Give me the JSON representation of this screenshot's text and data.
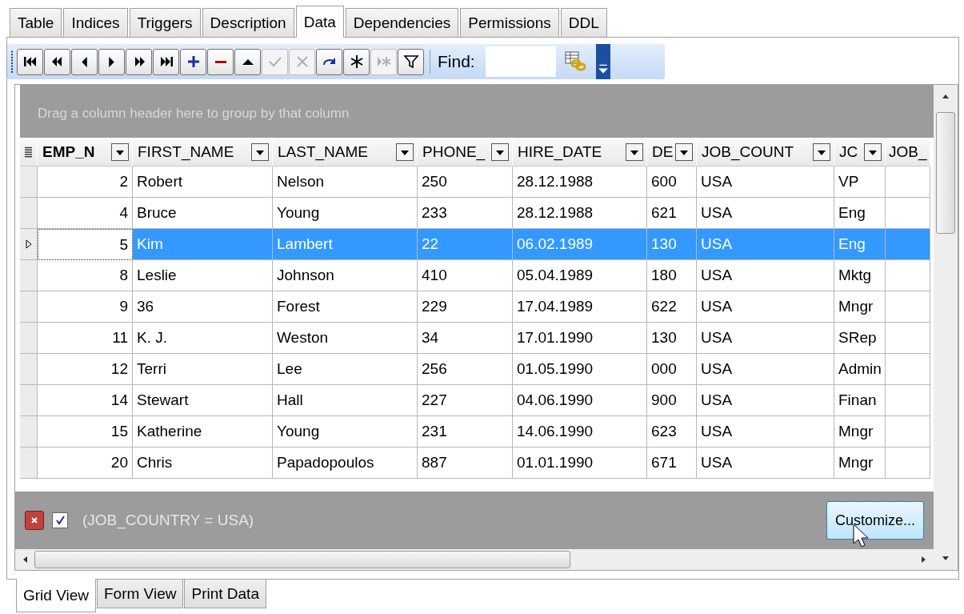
{
  "tabs": [
    {
      "label": "Table",
      "selected": false
    },
    {
      "label": "Indices",
      "selected": false
    },
    {
      "label": "Triggers",
      "selected": false
    },
    {
      "label": "Description",
      "selected": false
    },
    {
      "label": "Data",
      "selected": true
    },
    {
      "label": "Dependencies",
      "selected": false
    },
    {
      "label": "Permissions",
      "selected": false
    },
    {
      "label": "DDL",
      "selected": false
    }
  ],
  "toolbar": {
    "buttons": [
      {
        "kind": "first",
        "disabled": false
      },
      {
        "kind": "prior-page",
        "disabled": false
      },
      {
        "kind": "prior",
        "disabled": false
      },
      {
        "kind": "next",
        "disabled": false
      },
      {
        "kind": "next-page",
        "disabled": false
      },
      {
        "kind": "last",
        "disabled": false
      },
      {
        "kind": "insert",
        "disabled": false
      },
      {
        "kind": "delete",
        "disabled": false
      },
      {
        "kind": "edit",
        "disabled": false
      },
      {
        "kind": "post",
        "disabled": true
      },
      {
        "kind": "cancel",
        "disabled": true
      },
      {
        "kind": "refresh",
        "disabled": false
      },
      {
        "kind": "asterisk",
        "disabled": false
      },
      {
        "kind": "asterisk-arrow",
        "disabled": true
      },
      {
        "kind": "filter",
        "disabled": false
      }
    ],
    "find_label": "Find:"
  },
  "grid": {
    "group_panel_hint": "Drag a column header here to group by that column",
    "columns": [
      {
        "label": "EMP_N",
        "bold": true,
        "kind": "number"
      },
      {
        "label": "FIRST_NAME",
        "bold": false,
        "kind": "text"
      },
      {
        "label": "LAST_NAME",
        "bold": false,
        "kind": "text"
      },
      {
        "label": "PHONE_",
        "bold": false,
        "kind": "text"
      },
      {
        "label": "HIRE_DATE",
        "bold": false,
        "kind": "text"
      },
      {
        "label": "DE",
        "bold": false,
        "kind": "text"
      },
      {
        "label": "JOB_COUNT",
        "bold": false,
        "kind": "text"
      },
      {
        "label": "JC",
        "bold": false,
        "kind": "text"
      },
      {
        "label": "JOB_",
        "bold": false,
        "kind": "text"
      }
    ],
    "rows": [
      {
        "selected": false,
        "cells": [
          "2",
          "Robert",
          "Nelson",
          "250",
          "28.12.1988",
          "600",
          "USA",
          "VP"
        ]
      },
      {
        "selected": false,
        "cells": [
          "4",
          "Bruce",
          "Young",
          "233",
          "28.12.1988",
          "621",
          "USA",
          "Eng"
        ]
      },
      {
        "selected": true,
        "cells": [
          "5",
          "Kim",
          "Lambert",
          "22",
          "06.02.1989",
          "130",
          "USA",
          "Eng"
        ]
      },
      {
        "selected": false,
        "cells": [
          "8",
          "Leslie",
          "Johnson",
          "410",
          "05.04.1989",
          "180",
          "USA",
          "Mktg"
        ]
      },
      {
        "selected": false,
        "cells": [
          "9",
          "36",
          "Forest",
          "229",
          "17.04.1989",
          "622",
          "USA",
          "Mngr"
        ]
      },
      {
        "selected": false,
        "cells": [
          "11",
          "K. J.",
          "Weston",
          "34",
          "17.01.1990",
          "130",
          "USA",
          "SRep"
        ]
      },
      {
        "selected": false,
        "cells": [
          "12",
          "Terri",
          "Lee",
          "256",
          "01.05.1990",
          "000",
          "USA",
          "Admin"
        ]
      },
      {
        "selected": false,
        "cells": [
          "14",
          "Stewart",
          "Hall",
          "227",
          "04.06.1990",
          "900",
          "USA",
          "Finan"
        ]
      },
      {
        "selected": false,
        "cells": [
          "15",
          "Katherine",
          "Young",
          "231",
          "14.06.1990",
          "623",
          "USA",
          "Mngr"
        ]
      },
      {
        "selected": false,
        "cells": [
          "20",
          "Chris",
          "Papadopoulos",
          "887",
          "01.01.1990",
          "671",
          "USA",
          "Mngr"
        ]
      }
    ],
    "filter": {
      "checked": true,
      "text": "(JOB_COUNTRY = USA)",
      "customize_label": "Customize..."
    }
  },
  "view_tabs": [
    {
      "label": "Grid View",
      "selected": true
    },
    {
      "label": "Form View",
      "selected": false
    },
    {
      "label": "Print Data",
      "selected": false
    }
  ]
}
